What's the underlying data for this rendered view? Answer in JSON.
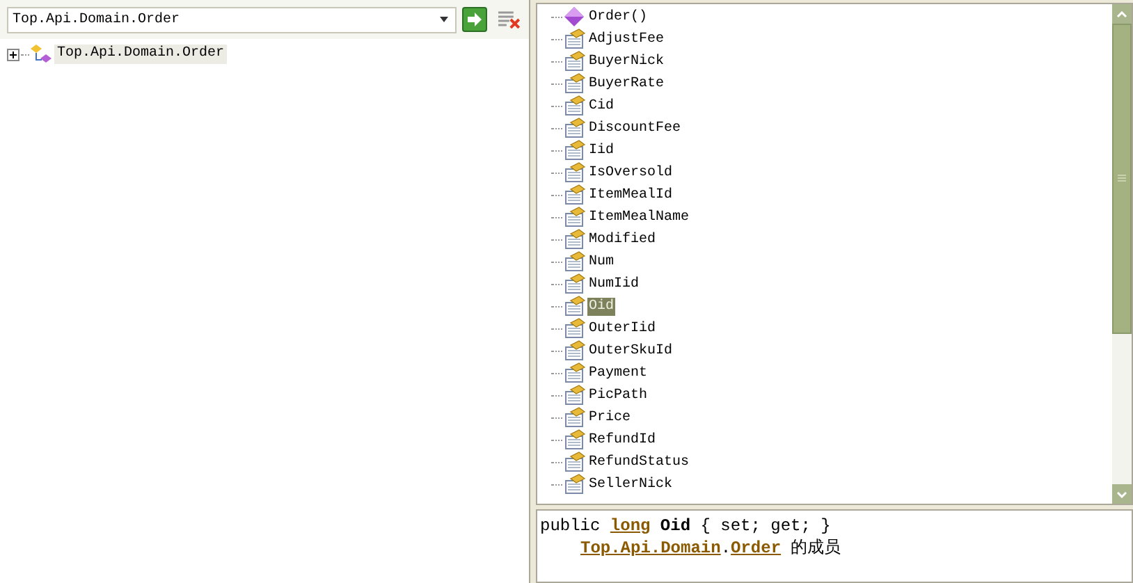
{
  "browse_field": {
    "value": "Top.Api.Domain.Order"
  },
  "tree": [
    {
      "label": "Top.Api.Domain.Order",
      "expanded": false,
      "selected": true
    }
  ],
  "members": [
    {
      "label": "Order()",
      "kind": "method",
      "selected": false
    },
    {
      "label": "AdjustFee",
      "kind": "property",
      "selected": false
    },
    {
      "label": "BuyerNick",
      "kind": "property",
      "selected": false
    },
    {
      "label": "BuyerRate",
      "kind": "property",
      "selected": false
    },
    {
      "label": "Cid",
      "kind": "property",
      "selected": false
    },
    {
      "label": "DiscountFee",
      "kind": "property",
      "selected": false
    },
    {
      "label": "Iid",
      "kind": "property",
      "selected": false
    },
    {
      "label": "IsOversold",
      "kind": "property",
      "selected": false
    },
    {
      "label": "ItemMealId",
      "kind": "property",
      "selected": false
    },
    {
      "label": "ItemMealName",
      "kind": "property",
      "selected": false
    },
    {
      "label": "Modified",
      "kind": "property",
      "selected": false
    },
    {
      "label": "Num",
      "kind": "property",
      "selected": false
    },
    {
      "label": "NumIid",
      "kind": "property",
      "selected": false
    },
    {
      "label": "Oid",
      "kind": "property",
      "selected": true
    },
    {
      "label": "OuterIid",
      "kind": "property",
      "selected": false
    },
    {
      "label": "OuterSkuId",
      "kind": "property",
      "selected": false
    },
    {
      "label": "Payment",
      "kind": "property",
      "selected": false
    },
    {
      "label": "PicPath",
      "kind": "property",
      "selected": false
    },
    {
      "label": "Price",
      "kind": "property",
      "selected": false
    },
    {
      "label": "RefundId",
      "kind": "property",
      "selected": false
    },
    {
      "label": "RefundStatus",
      "kind": "property",
      "selected": false
    },
    {
      "label": "SellerNick",
      "kind": "property",
      "selected": false
    }
  ],
  "description": {
    "signature": [
      {
        "text": "public ",
        "kind": "plain"
      },
      {
        "text": "long",
        "kind": "link"
      },
      {
        "text": " Oid",
        "kind": "bold"
      },
      {
        "text": " { set; get; }",
        "kind": "plain"
      }
    ],
    "member_of": [
      {
        "text": "Top.Api.Domain",
        "kind": "link"
      },
      {
        "text": ".",
        "kind": "plain"
      },
      {
        "text": "Order",
        "kind": "link"
      },
      {
        "text": " 的成员",
        "kind": "plain"
      }
    ]
  }
}
